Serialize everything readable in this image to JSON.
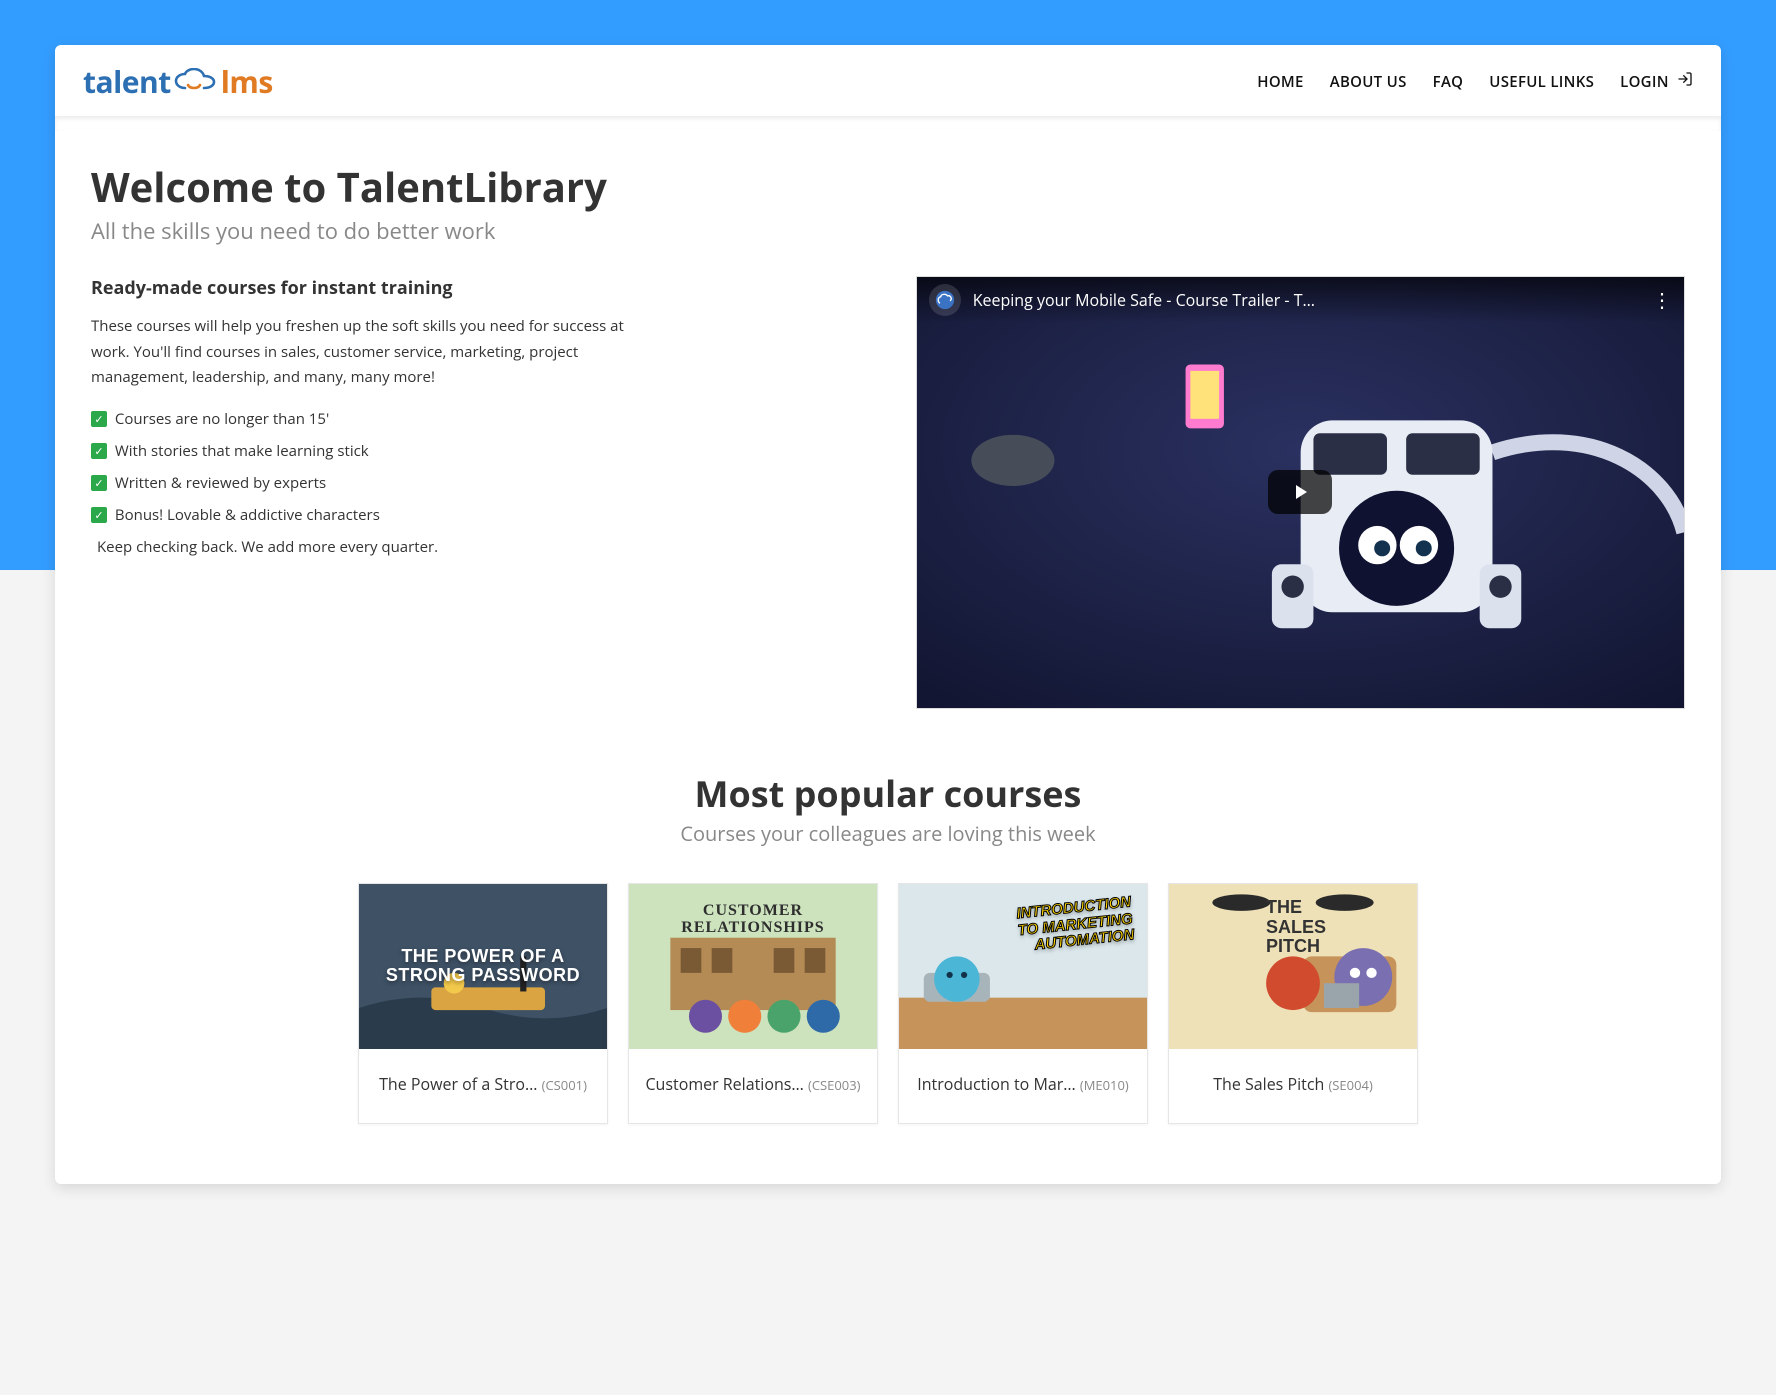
{
  "nav": {
    "items": [
      {
        "label": "HOME"
      },
      {
        "label": "ABOUT US"
      },
      {
        "label": "FAQ"
      },
      {
        "label": "USEFUL LINKS"
      }
    ],
    "login_label": "LOGIN"
  },
  "logo": {
    "part1": "talent",
    "part2": "lms"
  },
  "hero": {
    "title": "Welcome to TalentLibrary",
    "tagline": "All the skills you need to do better work"
  },
  "intro": {
    "heading": "Ready-made courses for instant training",
    "description": "These courses will help you freshen up the soft skills you need for success at work. You'll find courses in sales, customer service, marketing, project management, leadership, and many, many more!",
    "features": [
      "Courses are no longer than 15'",
      "With stories that make learning stick",
      "Written & reviewed by experts",
      "Bonus! Lovable & addictive characters"
    ],
    "note": "Keep checking back. We add more every quarter."
  },
  "video": {
    "title": "Keeping your Mobile Safe - Course Trailer - T…"
  },
  "popular": {
    "title": "Most popular courses",
    "subtitle": "Courses your colleagues are loving this week",
    "courses": [
      {
        "title": "The Power of a Stro…",
        "code": "(CS001)",
        "thumb_text": "THE POWER OF A\nSTRONG PASSWORD"
      },
      {
        "title": "Customer Relations…",
        "code": "(CSE003)",
        "thumb_text": "CUSTOMER\nRELATIONSHIPS"
      },
      {
        "title": "Introduction to Mar…",
        "code": "(ME010)",
        "thumb_text": "INTRODUCTION\nTO MARKETING\nAUTOMATION"
      },
      {
        "title": "The Sales Pitch",
        "code": "(SE004)",
        "thumb_text": "THE\nSALES\nPITCH"
      }
    ]
  }
}
